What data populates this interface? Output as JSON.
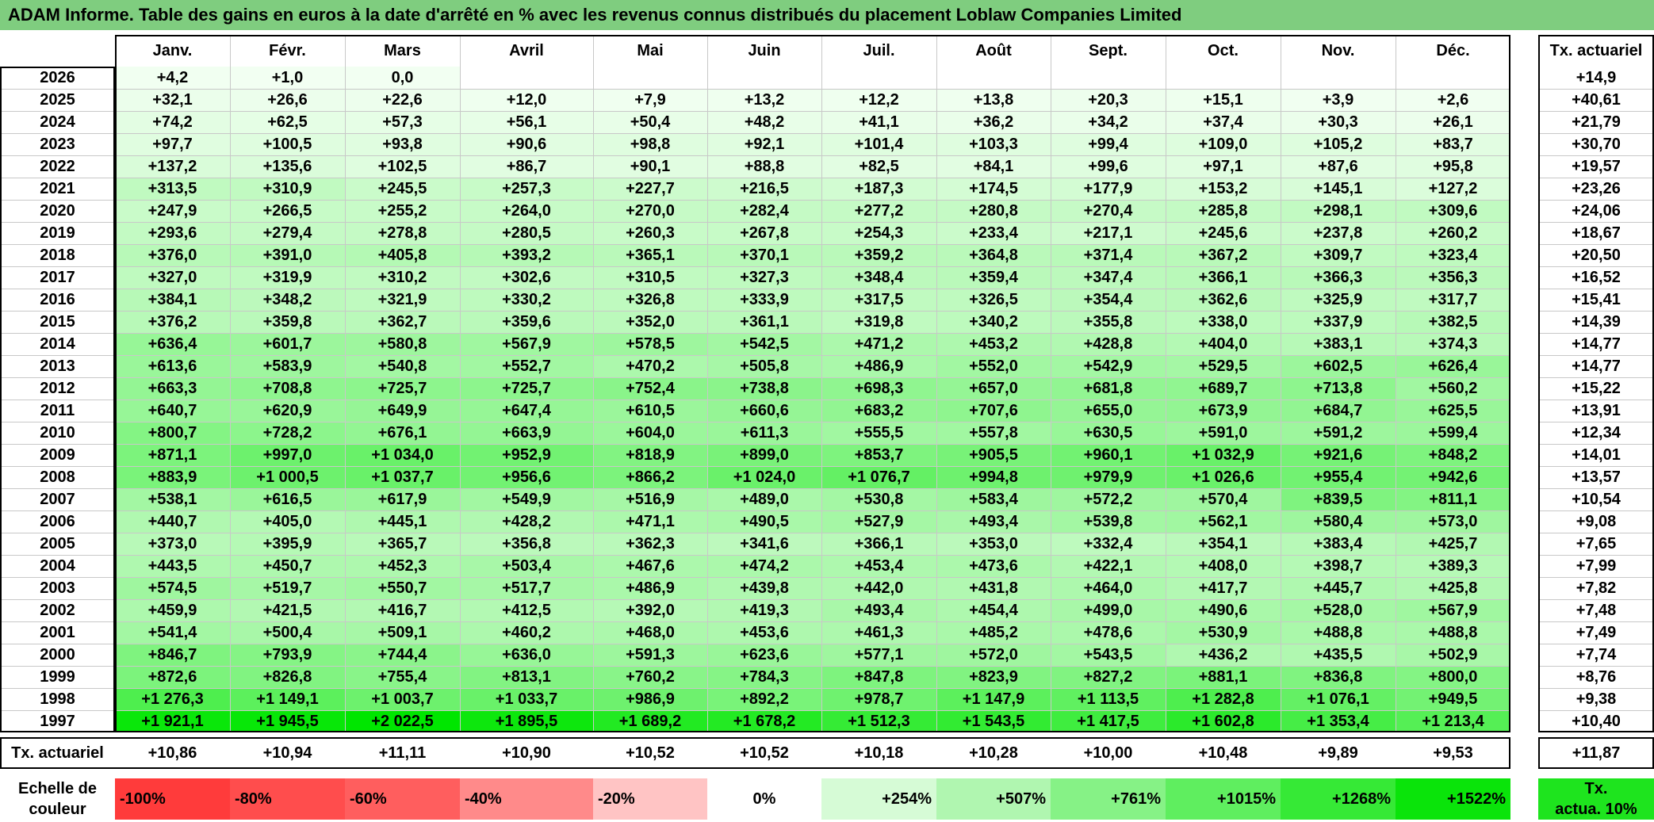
{
  "title": "ADAM Informe. Table des gains en euros à la date d'arrêté en % avec les revenus connus distribués du placement Loblaw Companies Limited",
  "chart_data": {
    "type": "table",
    "months": [
      "Janv.",
      "Févr.",
      "Mars",
      "Avril",
      "Mai",
      "Juin",
      "Juil.",
      "Août",
      "Sept.",
      "Oct.",
      "Nov.",
      "Déc."
    ],
    "rate_header": "Tx. actuariel",
    "rows": [
      {
        "year": "2026",
        "values": [
          "+4,2",
          "+1,0",
          "0,0",
          "",
          "",
          "",
          "",
          "",
          "",
          "",
          "",
          ""
        ],
        "nums": [
          4.2,
          1.0,
          0.0,
          null,
          null,
          null,
          null,
          null,
          null,
          null,
          null,
          null
        ],
        "rate": "+14,9"
      },
      {
        "year": "2025",
        "values": [
          "+32,1",
          "+26,6",
          "+22,6",
          "+12,0",
          "+7,9",
          "+13,2",
          "+12,2",
          "+13,8",
          "+20,3",
          "+15,1",
          "+3,9",
          "+2,6"
        ],
        "nums": [
          32.1,
          26.6,
          22.6,
          12.0,
          7.9,
          13.2,
          12.2,
          13.8,
          20.3,
          15.1,
          3.9,
          2.6
        ],
        "rate": "+40,61"
      },
      {
        "year": "2024",
        "values": [
          "+74,2",
          "+62,5",
          "+57,3",
          "+56,1",
          "+50,4",
          "+48,2",
          "+41,1",
          "+36,2",
          "+34,2",
          "+37,4",
          "+30,3",
          "+26,1"
        ],
        "nums": [
          74.2,
          62.5,
          57.3,
          56.1,
          50.4,
          48.2,
          41.1,
          36.2,
          34.2,
          37.4,
          30.3,
          26.1
        ],
        "rate": "+21,79"
      },
      {
        "year": "2023",
        "values": [
          "+97,7",
          "+100,5",
          "+93,8",
          "+90,6",
          "+98,8",
          "+92,1",
          "+101,4",
          "+103,3",
          "+99,4",
          "+109,0",
          "+105,2",
          "+83,7"
        ],
        "nums": [
          97.7,
          100.5,
          93.8,
          90.6,
          98.8,
          92.1,
          101.4,
          103.3,
          99.4,
          109.0,
          105.2,
          83.7
        ],
        "rate": "+30,70"
      },
      {
        "year": "2022",
        "values": [
          "+137,2",
          "+135,6",
          "+102,5",
          "+86,7",
          "+90,1",
          "+88,8",
          "+82,5",
          "+84,1",
          "+99,6",
          "+97,1",
          "+87,6",
          "+95,8"
        ],
        "nums": [
          137.2,
          135.6,
          102.5,
          86.7,
          90.1,
          88.8,
          82.5,
          84.1,
          99.6,
          97.1,
          87.6,
          95.8
        ],
        "rate": "+19,57"
      },
      {
        "year": "2021",
        "values": [
          "+313,5",
          "+310,9",
          "+245,5",
          "+257,3",
          "+227,7",
          "+216,5",
          "+187,3",
          "+174,5",
          "+177,9",
          "+153,2",
          "+145,1",
          "+127,2"
        ],
        "nums": [
          313.5,
          310.9,
          245.5,
          257.3,
          227.7,
          216.5,
          187.3,
          174.5,
          177.9,
          153.2,
          145.1,
          127.2
        ],
        "rate": "+23,26"
      },
      {
        "year": "2020",
        "values": [
          "+247,9",
          "+266,5",
          "+255,2",
          "+264,0",
          "+270,0",
          "+282,4",
          "+277,2",
          "+280,8",
          "+270,4",
          "+285,8",
          "+298,1",
          "+309,6"
        ],
        "nums": [
          247.9,
          266.5,
          255.2,
          264.0,
          270.0,
          282.4,
          277.2,
          280.8,
          270.4,
          285.8,
          298.1,
          309.6
        ],
        "rate": "+24,06"
      },
      {
        "year": "2019",
        "values": [
          "+293,6",
          "+279,4",
          "+278,8",
          "+280,5",
          "+260,3",
          "+267,8",
          "+254,3",
          "+233,4",
          "+217,1",
          "+245,6",
          "+237,8",
          "+260,2"
        ],
        "nums": [
          293.6,
          279.4,
          278.8,
          280.5,
          260.3,
          267.8,
          254.3,
          233.4,
          217.1,
          245.6,
          237.8,
          260.2
        ],
        "rate": "+18,67"
      },
      {
        "year": "2018",
        "values": [
          "+376,0",
          "+391,0",
          "+405,8",
          "+393,2",
          "+365,1",
          "+370,1",
          "+359,2",
          "+364,8",
          "+371,4",
          "+367,2",
          "+309,7",
          "+323,4"
        ],
        "nums": [
          376.0,
          391.0,
          405.8,
          393.2,
          365.1,
          370.1,
          359.2,
          364.8,
          371.4,
          367.2,
          309.7,
          323.4
        ],
        "rate": "+20,50"
      },
      {
        "year": "2017",
        "values": [
          "+327,0",
          "+319,9",
          "+310,2",
          "+302,6",
          "+310,5",
          "+327,3",
          "+348,4",
          "+359,4",
          "+347,4",
          "+366,1",
          "+366,3",
          "+356,3"
        ],
        "nums": [
          327.0,
          319.9,
          310.2,
          302.6,
          310.5,
          327.3,
          348.4,
          359.4,
          347.4,
          366.1,
          366.3,
          356.3
        ],
        "rate": "+16,52"
      },
      {
        "year": "2016",
        "values": [
          "+384,1",
          "+348,2",
          "+321,9",
          "+330,2",
          "+326,8",
          "+333,9",
          "+317,5",
          "+326,5",
          "+354,4",
          "+362,6",
          "+325,9",
          "+317,7"
        ],
        "nums": [
          384.1,
          348.2,
          321.9,
          330.2,
          326.8,
          333.9,
          317.5,
          326.5,
          354.4,
          362.6,
          325.9,
          317.7
        ],
        "rate": "+15,41"
      },
      {
        "year": "2015",
        "values": [
          "+376,2",
          "+359,8",
          "+362,7",
          "+359,6",
          "+352,0",
          "+361,1",
          "+319,8",
          "+340,2",
          "+355,8",
          "+338,0",
          "+337,9",
          "+382,5"
        ],
        "nums": [
          376.2,
          359.8,
          362.7,
          359.6,
          352.0,
          361.1,
          319.8,
          340.2,
          355.8,
          338.0,
          337.9,
          382.5
        ],
        "rate": "+14,39"
      },
      {
        "year": "2014",
        "values": [
          "+636,4",
          "+601,7",
          "+580,8",
          "+567,9",
          "+578,5",
          "+542,5",
          "+471,2",
          "+453,2",
          "+428,8",
          "+404,0",
          "+383,1",
          "+374,3"
        ],
        "nums": [
          636.4,
          601.7,
          580.8,
          567.9,
          578.5,
          542.5,
          471.2,
          453.2,
          428.8,
          404.0,
          383.1,
          374.3
        ],
        "rate": "+14,77"
      },
      {
        "year": "2013",
        "values": [
          "+613,6",
          "+583,9",
          "+540,8",
          "+552,7",
          "+470,2",
          "+505,8",
          "+486,9",
          "+552,0",
          "+542,9",
          "+529,5",
          "+602,5",
          "+626,4"
        ],
        "nums": [
          613.6,
          583.9,
          540.8,
          552.7,
          470.2,
          505.8,
          486.9,
          552.0,
          542.9,
          529.5,
          602.5,
          626.4
        ],
        "rate": "+14,77"
      },
      {
        "year": "2012",
        "values": [
          "+663,3",
          "+708,8",
          "+725,7",
          "+725,7",
          "+752,4",
          "+738,8",
          "+698,3",
          "+657,0",
          "+681,8",
          "+689,7",
          "+713,8",
          "+560,2"
        ],
        "nums": [
          663.3,
          708.8,
          725.7,
          725.7,
          752.4,
          738.8,
          698.3,
          657.0,
          681.8,
          689.7,
          713.8,
          560.2
        ],
        "rate": "+15,22"
      },
      {
        "year": "2011",
        "values": [
          "+640,7",
          "+620,9",
          "+649,9",
          "+647,4",
          "+610,5",
          "+660,6",
          "+683,2",
          "+707,6",
          "+655,0",
          "+673,9",
          "+684,7",
          "+625,5"
        ],
        "nums": [
          640.7,
          620.9,
          649.9,
          647.4,
          610.5,
          660.6,
          683.2,
          707.6,
          655.0,
          673.9,
          684.7,
          625.5
        ],
        "rate": "+13,91"
      },
      {
        "year": "2010",
        "values": [
          "+800,7",
          "+728,2",
          "+676,1",
          "+663,9",
          "+604,0",
          "+611,3",
          "+555,5",
          "+557,8",
          "+630,5",
          "+591,0",
          "+591,2",
          "+599,4"
        ],
        "nums": [
          800.7,
          728.2,
          676.1,
          663.9,
          604.0,
          611.3,
          555.5,
          557.8,
          630.5,
          591.0,
          591.2,
          599.4
        ],
        "rate": "+12,34"
      },
      {
        "year": "2009",
        "values": [
          "+871,1",
          "+997,0",
          "+1 034,0",
          "+952,9",
          "+818,9",
          "+899,0",
          "+853,7",
          "+905,5",
          "+960,1",
          "+1 032,9",
          "+921,6",
          "+848,2"
        ],
        "nums": [
          871.1,
          997.0,
          1034.0,
          952.9,
          818.9,
          899.0,
          853.7,
          905.5,
          960.1,
          1032.9,
          921.6,
          848.2
        ],
        "rate": "+14,01"
      },
      {
        "year": "2008",
        "values": [
          "+883,9",
          "+1 000,5",
          "+1 037,7",
          "+956,6",
          "+866,2",
          "+1 024,0",
          "+1 076,7",
          "+994,8",
          "+979,9",
          "+1 026,6",
          "+955,4",
          "+942,6"
        ],
        "nums": [
          883.9,
          1000.5,
          1037.7,
          956.6,
          866.2,
          1024.0,
          1076.7,
          994.8,
          979.9,
          1026.6,
          955.4,
          942.6
        ],
        "rate": "+13,57"
      },
      {
        "year": "2007",
        "values": [
          "+538,1",
          "+616,5",
          "+617,9",
          "+549,9",
          "+516,9",
          "+489,0",
          "+530,8",
          "+583,4",
          "+572,2",
          "+570,4",
          "+839,5",
          "+811,1"
        ],
        "nums": [
          538.1,
          616.5,
          617.9,
          549.9,
          516.9,
          489.0,
          530.8,
          583.4,
          572.2,
          570.4,
          839.5,
          811.1
        ],
        "rate": "+10,54"
      },
      {
        "year": "2006",
        "values": [
          "+440,7",
          "+405,0",
          "+445,1",
          "+428,2",
          "+471,1",
          "+490,5",
          "+527,9",
          "+493,4",
          "+539,8",
          "+562,1",
          "+580,4",
          "+573,0"
        ],
        "nums": [
          440.7,
          405.0,
          445.1,
          428.2,
          471.1,
          490.5,
          527.9,
          493.4,
          539.8,
          562.1,
          580.4,
          573.0
        ],
        "rate": "+9,08"
      },
      {
        "year": "2005",
        "values": [
          "+373,0",
          "+395,9",
          "+365,7",
          "+356,8",
          "+362,3",
          "+341,6",
          "+366,1",
          "+353,0",
          "+332,4",
          "+354,1",
          "+383,4",
          "+425,7"
        ],
        "nums": [
          373.0,
          395.9,
          365.7,
          356.8,
          362.3,
          341.6,
          366.1,
          353.0,
          332.4,
          354.1,
          383.4,
          425.7
        ],
        "rate": "+7,65"
      },
      {
        "year": "2004",
        "values": [
          "+443,5",
          "+450,7",
          "+452,3",
          "+503,4",
          "+467,6",
          "+474,2",
          "+453,4",
          "+473,6",
          "+422,1",
          "+408,0",
          "+398,7",
          "+389,3"
        ],
        "nums": [
          443.5,
          450.7,
          452.3,
          503.4,
          467.6,
          474.2,
          453.4,
          473.6,
          422.1,
          408.0,
          398.7,
          389.3
        ],
        "rate": "+7,99"
      },
      {
        "year": "2003",
        "values": [
          "+574,5",
          "+519,7",
          "+550,7",
          "+517,7",
          "+486,9",
          "+439,8",
          "+442,0",
          "+431,8",
          "+464,0",
          "+417,7",
          "+445,7",
          "+425,8"
        ],
        "nums": [
          574.5,
          519.7,
          550.7,
          517.7,
          486.9,
          439.8,
          442.0,
          431.8,
          464.0,
          417.7,
          445.7,
          425.8
        ],
        "rate": "+7,82"
      },
      {
        "year": "2002",
        "values": [
          "+459,9",
          "+421,5",
          "+416,7",
          "+412,5",
          "+392,0",
          "+419,3",
          "+493,4",
          "+454,4",
          "+499,0",
          "+490,6",
          "+528,0",
          "+567,9"
        ],
        "nums": [
          459.9,
          421.5,
          416.7,
          412.5,
          392.0,
          419.3,
          493.4,
          454.4,
          499.0,
          490.6,
          528.0,
          567.9
        ],
        "rate": "+7,48"
      },
      {
        "year": "2001",
        "values": [
          "+541,4",
          "+500,4",
          "+509,1",
          "+460,2",
          "+468,0",
          "+453,6",
          "+461,3",
          "+485,2",
          "+478,6",
          "+530,9",
          "+488,8",
          "+488,8"
        ],
        "nums": [
          541.4,
          500.4,
          509.1,
          460.2,
          468.0,
          453.6,
          461.3,
          485.2,
          478.6,
          530.9,
          488.8,
          488.8
        ],
        "rate": "+7,49"
      },
      {
        "year": "2000",
        "values": [
          "+846,7",
          "+793,9",
          "+744,4",
          "+636,0",
          "+591,3",
          "+623,6",
          "+577,1",
          "+572,0",
          "+543,5",
          "+436,2",
          "+435,5",
          "+502,9"
        ],
        "nums": [
          846.7,
          793.9,
          744.4,
          636.0,
          591.3,
          623.6,
          577.1,
          572.0,
          543.5,
          436.2,
          435.5,
          502.9
        ],
        "rate": "+7,74"
      },
      {
        "year": "1999",
        "values": [
          "+872,6",
          "+826,8",
          "+755,4",
          "+813,1",
          "+760,2",
          "+784,3",
          "+847,8",
          "+823,9",
          "+827,2",
          "+881,1",
          "+836,8",
          "+800,0"
        ],
        "nums": [
          872.6,
          826.8,
          755.4,
          813.1,
          760.2,
          784.3,
          847.8,
          823.9,
          827.2,
          881.1,
          836.8,
          800.0
        ],
        "rate": "+8,76"
      },
      {
        "year": "1998",
        "values": [
          "+1 276,3",
          "+1 149,1",
          "+1 003,7",
          "+1 033,7",
          "+986,9",
          "+892,2",
          "+978,7",
          "+1 147,9",
          "+1 113,5",
          "+1 282,8",
          "+1 076,1",
          "+949,5"
        ],
        "nums": [
          1276.3,
          1149.1,
          1003.7,
          1033.7,
          986.9,
          892.2,
          978.7,
          1147.9,
          1113.5,
          1282.8,
          1076.1,
          949.5
        ],
        "rate": "+9,38"
      },
      {
        "year": "1997",
        "values": [
          "+1 921,1",
          "+1 945,5",
          "+2 022,5",
          "+1 895,5",
          "+1 689,2",
          "+1 678,2",
          "+1 512,3",
          "+1 543,5",
          "+1 417,5",
          "+1 602,8",
          "+1 353,4",
          "+1 213,4"
        ],
        "nums": [
          1921.1,
          1945.5,
          2022.5,
          1895.5,
          1689.2,
          1678.2,
          1512.3,
          1543.5,
          1417.5,
          1602.8,
          1353.4,
          1213.4
        ],
        "rate": "+10,40"
      }
    ],
    "footer": {
      "label": "Tx. actuariel",
      "values": [
        "+10,86",
        "+10,94",
        "+11,11",
        "+10,90",
        "+10,52",
        "+10,52",
        "+10,18",
        "+10,28",
        "+10,00",
        "+10,48",
        "+9,89",
        "+9,53"
      ],
      "total": "+11,87"
    },
    "legend": {
      "label_line1": "Echelle de",
      "label_line2": "couleur",
      "items": [
        {
          "label": "-100%",
          "color": "#ff3b3b",
          "align": "left"
        },
        {
          "label": "-80%",
          "color": "#ff4d4d",
          "align": "left"
        },
        {
          "label": "-60%",
          "color": "#ff5e5e",
          "align": "left"
        },
        {
          "label": "-40%",
          "color": "#ff8a8a",
          "align": "left"
        },
        {
          "label": "-20%",
          "color": "#ffc4c4",
          "align": "left"
        },
        {
          "label": "0%",
          "color": "#ffffff",
          "align": "center"
        },
        {
          "label": "+254%",
          "color": "#d6fbd6",
          "align": "right"
        },
        {
          "label": "+507%",
          "color": "#b0f6b0",
          "align": "right"
        },
        {
          "label": "+761%",
          "color": "#86f286",
          "align": "right"
        },
        {
          "label": "+1015%",
          "color": "#5fee5f",
          "align": "right"
        },
        {
          "label": "+1268%",
          "color": "#36e936",
          "align": "right"
        },
        {
          "label": "+1522%",
          "color": "#0ae40a",
          "align": "right"
        }
      ],
      "rate_line1": "Tx.",
      "rate_line2": "actua. 10%",
      "rate_color": "#1ee41e"
    },
    "colors": {
      "title_bg": "#7fcd7f",
      "max_green": "#00e600",
      "frame": "#000000"
    }
  }
}
